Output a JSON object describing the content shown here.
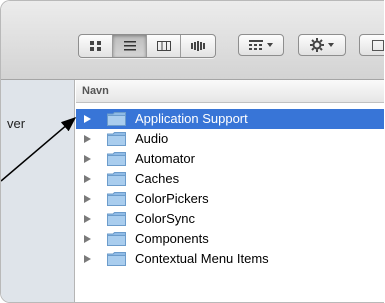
{
  "sidebar": {
    "partial_text": "ver"
  },
  "column_header": {
    "name_label": "Navn"
  },
  "toolbar": {
    "view_buttons": [
      "icon-view-icon",
      "list-view-icon",
      "column-view-icon",
      "coverflow-view-icon"
    ],
    "active_view": "list-view-icon",
    "arrange_icon": "arrange-grid-icon",
    "action_icon": "gear-icon"
  },
  "files": [
    {
      "name": "Application Support",
      "selected": true
    },
    {
      "name": "Audio",
      "selected": false
    },
    {
      "name": "Automator",
      "selected": false
    },
    {
      "name": "Caches",
      "selected": false
    },
    {
      "name": "ColorPickers",
      "selected": false
    },
    {
      "name": "ColorSync",
      "selected": false
    },
    {
      "name": "Components",
      "selected": false
    },
    {
      "name": "Contextual Menu Items",
      "selected": false
    }
  ],
  "colors": {
    "selection": "#3875d7",
    "folder": "#8fbbe6"
  }
}
